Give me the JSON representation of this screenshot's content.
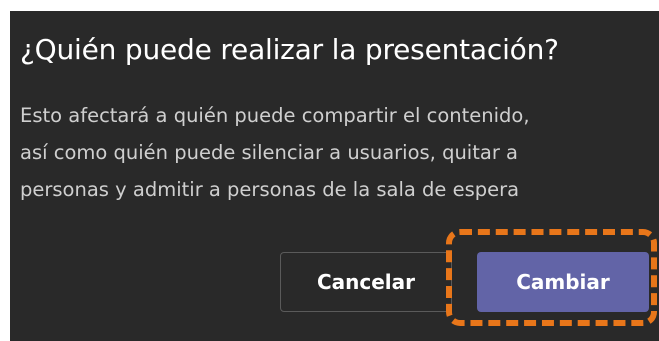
{
  "dialog": {
    "title": "¿Quién puede realizar la presentación?",
    "body_lines": [
      "Esto afectará a quién puede compartir el contenido,",
      "así como quién puede silenciar a usuarios, quitar a",
      "personas y admitir a personas de la sala de espera"
    ],
    "cancel_label": "Cancelar",
    "confirm_label": "Cambiar"
  },
  "colors": {
    "dialog_background": "#292929",
    "primary_button": "#6264a7",
    "highlight": "#e8761a"
  }
}
